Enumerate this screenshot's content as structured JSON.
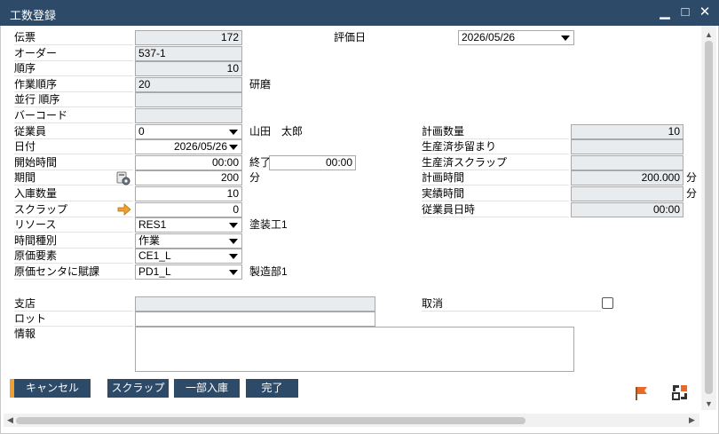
{
  "window": {
    "title": "工数登録"
  },
  "form": {
    "document": {
      "label": "伝票",
      "value": "172"
    },
    "order": {
      "label": "オーダー",
      "value": "537-1"
    },
    "sequence": {
      "label": "順序",
      "value": "10"
    },
    "work_sequence": {
      "label": "作業順序",
      "value": "20",
      "desc": "研磨"
    },
    "parallel_sequence": {
      "label": "並行 順序",
      "value": ""
    },
    "barcode": {
      "label": "バーコード",
      "value": ""
    },
    "employee": {
      "label": "従業員",
      "value": "0",
      "desc": "山田　太郎"
    },
    "date": {
      "label": "日付",
      "value": "2026/05/26"
    },
    "start_time": {
      "label": "開始時間",
      "value": "00:00"
    },
    "end_time": {
      "label": "終了",
      "value": "00:00"
    },
    "period": {
      "label": "期間",
      "value": "200",
      "unit": "分"
    },
    "received_qty": {
      "label": "入庫数量",
      "value": "10"
    },
    "scrap": {
      "label": "スクラップ",
      "value": "0"
    },
    "resource": {
      "label": "リソース",
      "value": "RES1",
      "desc": "塗装工1"
    },
    "time_type": {
      "label": "時間種別",
      "value": "作業"
    },
    "cost_element": {
      "label": "原価要素",
      "value": "CE1_L"
    },
    "cost_center": {
      "label": "原価センタに賦課",
      "value": "PD1_L",
      "desc": "製造部1"
    },
    "eval_date": {
      "label": "評価日",
      "value": "2026/05/26"
    },
    "planned_qty": {
      "label": "計画数量",
      "value": "10"
    },
    "yield_done": {
      "label": "生産済歩留まり",
      "value": ""
    },
    "scrap_done": {
      "label": "生産済スクラップ",
      "value": ""
    },
    "planned_time": {
      "label": "計画時間",
      "value": "200.000",
      "unit": "分"
    },
    "actual_time": {
      "label": "実績時間",
      "value": "",
      "unit": "分"
    },
    "employee_datetime": {
      "label": "従業員日時",
      "value": "00:00"
    },
    "branch": {
      "label": "支店",
      "value": ""
    },
    "lot": {
      "label": "ロット",
      "value": ""
    },
    "info": {
      "label": "情報",
      "value": ""
    },
    "cancel": {
      "label": "取消",
      "checked": false
    }
  },
  "buttons": {
    "cancel": "キャンセル",
    "scrap": "スクラップ",
    "partial_receipt": "一部入庫",
    "complete": "完了"
  },
  "icons": {
    "calculator": "calculator-gear-icon",
    "arrow": "orange-arrow-icon",
    "flag": "flag-icon",
    "layout": "layout-icon"
  },
  "colors": {
    "titlebar": "#2d4a68",
    "accent": "#f0a030"
  }
}
